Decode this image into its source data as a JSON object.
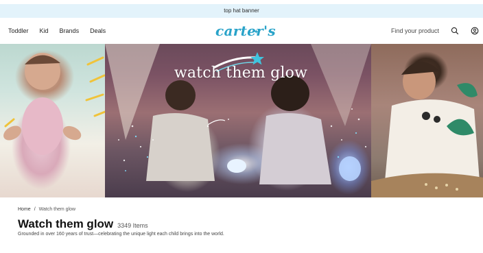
{
  "banner": {
    "text": "top hat banner"
  },
  "nav": {
    "links": [
      "Toddler",
      "Kid",
      "Brands",
      "Deals"
    ],
    "logo_text": "carter's",
    "search": {
      "placeholder": "Find your product"
    }
  },
  "hero": {
    "headline": "watch them glow"
  },
  "breadcrumb": {
    "home": "Home",
    "separator": "/",
    "current": "Watch them glow"
  },
  "page": {
    "title": "Watch them glow",
    "item_count": "3349 Items",
    "description": "Grounded in over 160 years of trust—celebrating the unique light each child brings into the world."
  },
  "colors": {
    "banner_bg": "#e3f3fb",
    "brand_blue": "#29a3c9"
  },
  "icons": [
    "search-icon",
    "account-icon",
    "star-icon",
    "swoosh-icon"
  ]
}
